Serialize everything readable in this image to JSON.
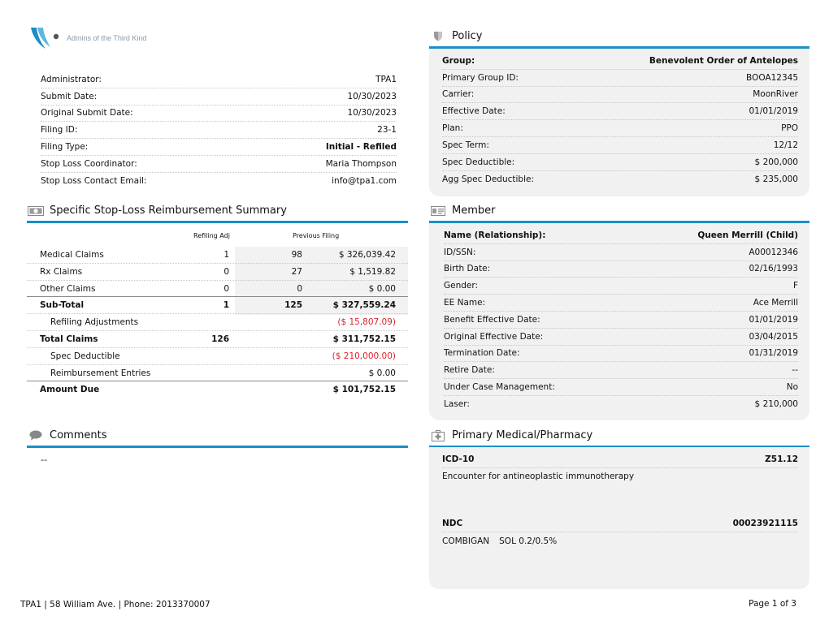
{
  "logo": {
    "text": "Admins of the Third Kind"
  },
  "filing": {
    "rows": [
      {
        "label": "Administrator:",
        "value": "TPA1"
      },
      {
        "label": "Submit Date:",
        "value": "10/30/2023"
      },
      {
        "label": "Original Submit Date:",
        "value": "10/30/2023"
      },
      {
        "label": "Filing ID:",
        "value": "23-1"
      },
      {
        "label": "Filing Type:",
        "value": "Initial - Refiled"
      },
      {
        "label": "Stop Loss Coordinator:",
        "value": "Maria Thompson"
      },
      {
        "label": "Stop Loss Contact Email:",
        "value": "info@tpa1.com"
      }
    ]
  },
  "policy": {
    "title": "Policy",
    "rows": [
      {
        "label": "Group:",
        "value": "Benevolent Order of Antelopes"
      },
      {
        "label": "Primary Group ID:",
        "value": "BOOA12345"
      },
      {
        "label": "Carrier:",
        "value": "MoonRiver"
      },
      {
        "label": "Effective Date:",
        "value": "01/01/2019"
      },
      {
        "label": "Plan:",
        "value": "PPO"
      },
      {
        "label": "Spec Term:",
        "value": "12/12"
      },
      {
        "label": "Spec Deductible:",
        "value": "$ 200,000"
      },
      {
        "label": "Agg Spec Deductible:",
        "value": "$ 235,000"
      }
    ]
  },
  "summary": {
    "title": "Specific Stop-Loss Reimbursement Summary",
    "col_refiling_adj": "Refiling Adj",
    "col_previous_filing": "Previous Filing",
    "rows": [
      {
        "label": "Medical Claims",
        "adj": "1",
        "prev": "98",
        "amount": "$ 326,039.42"
      },
      {
        "label": "Rx Claims",
        "adj": "0",
        "prev": "27",
        "amount": "$ 1,519.82"
      },
      {
        "label": "Other Claims",
        "adj": "0",
        "prev": "0",
        "amount": "$ 0.00"
      },
      {
        "label": "Sub-Total",
        "adj": "1",
        "prev": "125",
        "amount": "$ 327,559.24"
      },
      {
        "label": "Refiling Adjustments",
        "adj": "",
        "prev": "",
        "amount": "($ 15,807.09)"
      },
      {
        "label": "Total Claims",
        "adj": "126",
        "prev": "",
        "amount": "$ 311,752.15"
      },
      {
        "label": "Spec Deductible",
        "adj": "",
        "prev": "",
        "amount": "($ 210,000.00)"
      },
      {
        "label": "Reimbursement Entries",
        "adj": "",
        "prev": "",
        "amount": "$ 0.00"
      },
      {
        "label": "Amount Due",
        "adj": "",
        "prev": "",
        "amount": "$ 101,752.15"
      }
    ]
  },
  "member": {
    "title": "Member",
    "rows": [
      {
        "label": "Name (Relationship):",
        "value": "Queen Merrill (Child)"
      },
      {
        "label": "ID/SSN:",
        "value": "A00012346"
      },
      {
        "label": "Birth Date:",
        "value": "02/16/1993"
      },
      {
        "label": "Gender:",
        "value": "F"
      },
      {
        "label": "EE Name:",
        "value": "Ace Merrill"
      },
      {
        "label": "Benefit Effective Date:",
        "value": "01/01/2019"
      },
      {
        "label": "Original Effective Date:",
        "value": "03/04/2015"
      },
      {
        "label": "Termination Date:",
        "value": "01/31/2019"
      },
      {
        "label": "Retire Date:",
        "value": "--"
      },
      {
        "label": "Under Case Management:",
        "value": "No"
      },
      {
        "label": "Laser:",
        "value": "$ 210,000"
      }
    ]
  },
  "comments": {
    "title": "Comments",
    "text": "--"
  },
  "medical": {
    "title": "Primary Medical/Pharmacy",
    "icd_label": "ICD-10",
    "icd_code": "Z51.12",
    "icd_desc": "Encounter for antineoplastic immunotherapy",
    "ndc_label": "NDC",
    "ndc_code": "00023921115",
    "ndc_name": "COMBIGAN",
    "ndc_form": "SOL 0.2/0.5%"
  },
  "footer": {
    "left": "TPA1 | 58 William Ave. | Phone: 2013370007",
    "right": "Page 1 of 3"
  },
  "colors": {
    "accent": "#1b8fc6",
    "negative": "#d8232a",
    "panel": "#f1f1f1"
  }
}
